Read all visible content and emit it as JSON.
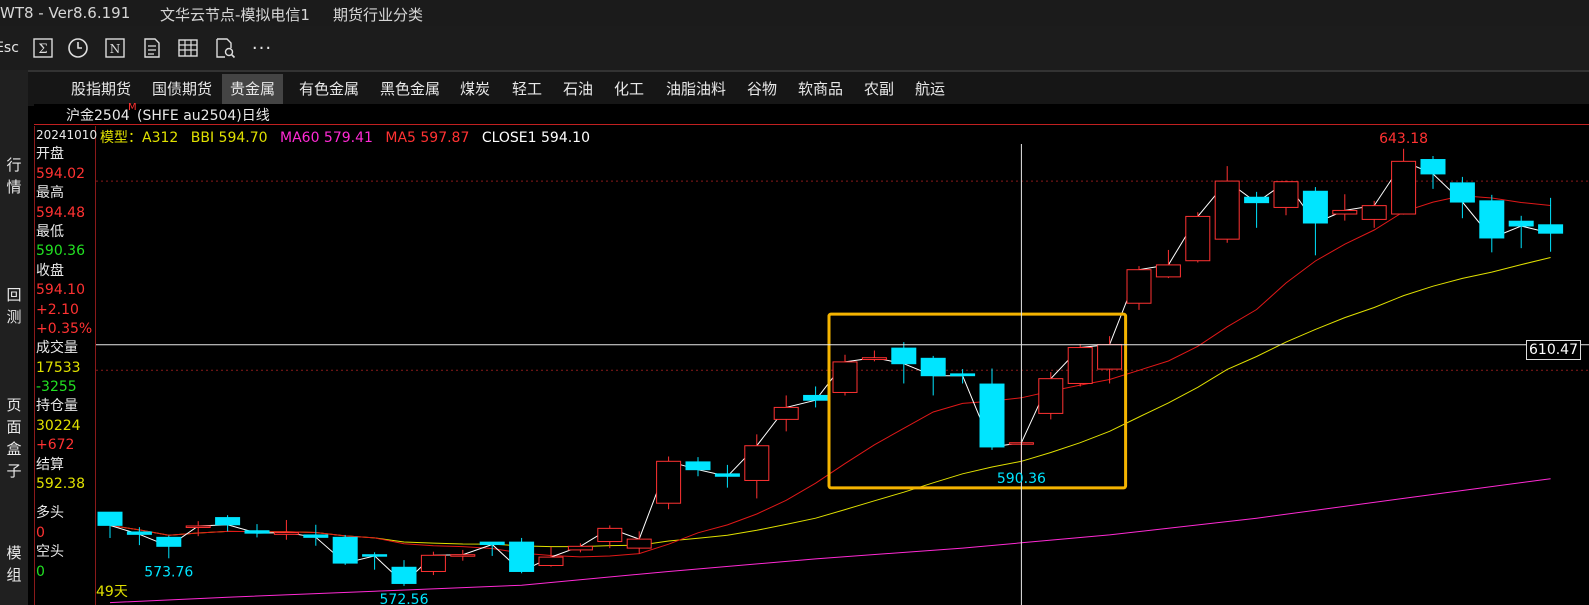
{
  "titlebar": {
    "app": "WT8  -  Ver8.6.191",
    "server": "文华云节点-模拟电信1",
    "category": "期货行业分类"
  },
  "toolbar": {
    "esc_label": "Esc",
    "icons": [
      "sigma-icon",
      "clock-icon",
      "n-box-icon",
      "document-icon",
      "table-icon",
      "search-doc-icon",
      "more-icon"
    ],
    "more_label": "···"
  },
  "left_tabs": [
    "行情",
    "回测",
    "页面盒子",
    "模组"
  ],
  "tabs": [
    {
      "label": "股指期货",
      "active": false
    },
    {
      "label": "国债期货",
      "active": false
    },
    {
      "label": "贵金属",
      "active": true
    },
    {
      "label": "有色金属",
      "active": false
    },
    {
      "label": "黑色金属",
      "active": false
    },
    {
      "label": "煤炭",
      "active": false
    },
    {
      "label": "轻工",
      "active": false
    },
    {
      "label": "石油",
      "active": false
    },
    {
      "label": "化工",
      "active": false
    },
    {
      "label": "油脂油料",
      "active": false
    },
    {
      "label": "谷物",
      "active": false
    },
    {
      "label": "软商品",
      "active": false
    },
    {
      "label": "农副",
      "active": false
    },
    {
      "label": "航运",
      "active": false
    }
  ],
  "header": {
    "symbol": "沪金2504",
    "superscript": "M",
    "code": "(SHFE au2504)日线"
  },
  "info": {
    "date": "20241010",
    "open_label": "开盘",
    "open": "594.02",
    "high_label": "最高",
    "high": "594.48",
    "low_label": "最低",
    "low": "590.36",
    "close_label": "收盘",
    "close": "594.10",
    "change": "+2.10",
    "change_pct": "+0.35%",
    "volume_label": "成交量",
    "volume": "17533",
    "volume_change": "-3255",
    "oi_label": "持仓量",
    "oi": "30224",
    "oi_change": "+672",
    "settle_label": "结算",
    "settle": "592.38",
    "long_label": "多头",
    "long": "0",
    "short_label": "空头",
    "short": "0"
  },
  "legend": {
    "model": "模型：A312",
    "bbi": "BBI 594.70",
    "ma60": "MA60 579.41",
    "ma5": "MA5 597.87",
    "close1": "CLOSE1 594.10"
  },
  "crosshair_price": "610.47",
  "days_label": "49天",
  "colors": {
    "up": "#ff3232",
    "down": "#00e5ff",
    "ma5": "#ffffff",
    "ma10": "#e01818",
    "ma20": "#e0e000",
    "ma60": "#ff2ad4",
    "box": "#f5b400"
  },
  "chart_data": {
    "type": "candlestick",
    "series_name": "沪金2504 日线",
    "candles": [
      {
        "o": 582.5,
        "c": 580.3,
        "h": 582.5,
        "l": 578.2
      },
      {
        "o": 579.2,
        "c": 578.8,
        "h": 580.0,
        "l": 577.0
      },
      {
        "o": 578.3,
        "c": 576.8,
        "h": 578.6,
        "l": 574.8
      },
      {
        "o": 580.0,
        "c": 580.2,
        "h": 581.0,
        "l": 578.5
      },
      {
        "o": 581.6,
        "c": 580.4,
        "h": 582.0,
        "l": 579.3
      },
      {
        "o": 579.4,
        "c": 579.0,
        "h": 580.5,
        "l": 578.3
      },
      {
        "o": 578.8,
        "c": 579.1,
        "h": 581.2,
        "l": 577.9
      },
      {
        "o": 578.7,
        "c": 578.3,
        "h": 580.4,
        "l": 576.9
      },
      {
        "o": 578.3,
        "c": 574.0,
        "h": 578.7,
        "l": 573.7
      },
      {
        "o": 575.4,
        "c": 575.2,
        "h": 575.8,
        "l": 572.9
      },
      {
        "o": 573.3,
        "c": 570.6,
        "h": 574.5,
        "l": 570.2
      },
      {
        "o": 572.6,
        "c": 575.3,
        "h": 575.9,
        "l": 572.0
      },
      {
        "o": 575.3,
        "c": 575.4,
        "h": 576.2,
        "l": 574.4
      },
      {
        "o": 577.5,
        "c": 577.1,
        "h": 577.5,
        "l": 575.2
      },
      {
        "o": 577.5,
        "c": 572.6,
        "h": 578.2,
        "l": 572.3
      },
      {
        "o": 573.6,
        "c": 575.0,
        "h": 576.7,
        "l": 573.4
      },
      {
        "o": 576.2,
        "c": 576.8,
        "h": 577.3,
        "l": 575.8
      },
      {
        "o": 577.6,
        "c": 579.8,
        "h": 580.3,
        "l": 576.5
      },
      {
        "o": 576.5,
        "c": 578.0,
        "h": 579.3,
        "l": 575.6
      },
      {
        "o": 584.0,
        "c": 591.0,
        "h": 591.8,
        "l": 583.0
      },
      {
        "o": 590.9,
        "c": 589.6,
        "h": 591.7,
        "l": 588.5
      },
      {
        "o": 588.9,
        "c": 588.5,
        "h": 590.4,
        "l": 586.6
      },
      {
        "o": 587.8,
        "c": 593.6,
        "h": 595.5,
        "l": 584.8
      },
      {
        "o": 598.0,
        "c": 600.0,
        "h": 602.0,
        "l": 596.0
      },
      {
        "o": 602.0,
        "c": 601.2,
        "h": 603.5,
        "l": 600.0
      },
      {
        "o": 602.5,
        "c": 607.6,
        "h": 608.8,
        "l": 602.0
      },
      {
        "o": 608.0,
        "c": 608.3,
        "h": 609.5,
        "l": 607.7
      },
      {
        "o": 609.9,
        "c": 607.3,
        "h": 610.9,
        "l": 604.0
      },
      {
        "o": 608.2,
        "c": 605.3,
        "h": 608.6,
        "l": 602.0
      },
      {
        "o": 605.6,
        "c": 605.3,
        "h": 606.4,
        "l": 604.0
      },
      {
        "o": 603.9,
        "c": 593.4,
        "h": 606.5,
        "l": 592.9
      },
      {
        "o": 594.0,
        "c": 594.1,
        "h": 594.5,
        "l": 590.4
      },
      {
        "o": 599.0,
        "c": 604.8,
        "h": 605.9,
        "l": 598.0
      },
      {
        "o": 604.0,
        "c": 610.0,
        "h": 610.6,
        "l": 603.5
      },
      {
        "o": 606.4,
        "c": 610.5,
        "h": 611.9,
        "l": 604.0
      },
      {
        "o": 617.4,
        "c": 623.0,
        "h": 623.6,
        "l": 616.3
      },
      {
        "o": 621.8,
        "c": 623.8,
        "h": 626.3,
        "l": 621.6
      },
      {
        "o": 624.5,
        "c": 631.9,
        "h": 632.6,
        "l": 624.2
      },
      {
        "o": 628.1,
        "c": 637.8,
        "h": 640.3,
        "l": 627.5
      },
      {
        "o": 635.1,
        "c": 634.2,
        "h": 636.0,
        "l": 630.0
      },
      {
        "o": 633.4,
        "c": 637.7,
        "h": 637.9,
        "l": 632.1
      },
      {
        "o": 636.1,
        "c": 630.8,
        "h": 636.8,
        "l": 625.4
      },
      {
        "o": 632.3,
        "c": 632.9,
        "h": 635.6,
        "l": 631.2
      },
      {
        "o": 631.4,
        "c": 633.7,
        "h": 634.5,
        "l": 630.0
      },
      {
        "o": 632.3,
        "c": 641.1,
        "h": 643.2,
        "l": 632.2
      },
      {
        "o": 641.4,
        "c": 639.0,
        "h": 642.0,
        "l": 636.5
      },
      {
        "o": 637.5,
        "c": 634.3,
        "h": 638.5,
        "l": 631.6
      },
      {
        "o": 634.5,
        "c": 628.3,
        "h": 635.5,
        "l": 625.9
      },
      {
        "o": 631.1,
        "c": 630.3,
        "h": 632.0,
        "l": 626.6
      },
      {
        "o": 630.5,
        "c": 629.1,
        "h": 635.0,
        "l": 626.0
      }
    ],
    "ma60": [
      [
        0,
        567.4
      ],
      [
        4,
        568.3
      ],
      [
        9,
        569.3
      ],
      [
        14,
        570.3
      ],
      [
        19,
        572.6
      ],
      [
        24,
        574.7
      ],
      [
        29,
        576.5
      ],
      [
        34,
        578.7
      ],
      [
        39,
        581.5
      ],
      [
        44,
        584.8
      ],
      [
        49,
        588.1
      ]
    ],
    "ylim": [
      567,
      647
    ],
    "annotations": [
      {
        "text": "643.18",
        "i": 44,
        "price": 643.2,
        "kind": "high"
      },
      {
        "text": "590.36",
        "i": 31,
        "price": 590.4,
        "kind": "low"
      },
      {
        "text": "573.76",
        "i": 2,
        "price": 574.8,
        "kind": "low"
      },
      {
        "text": "572.56",
        "i": 10,
        "price": 570.2,
        "kind": "low"
      }
    ],
    "dotted_levels": [
      637.8,
      606.2
    ],
    "crosshair_price": 610.47,
    "crosshair_index": 31,
    "highlight_range": [
      25,
      34
    ]
  }
}
